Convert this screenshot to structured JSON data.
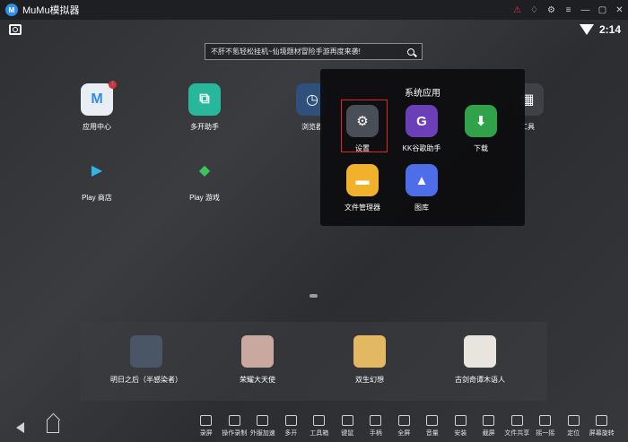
{
  "window": {
    "title": "MuMu模拟器",
    "logo_text": "M"
  },
  "status": {
    "time": "2:14"
  },
  "search": {
    "text": "不肝不氪轻松挂机~仙境题材冒险手游再度来袭!"
  },
  "home_apps": [
    {
      "label": "应用中心",
      "icon": "app-center-icon",
      "color": "#e9eef5",
      "glyph": "M",
      "badge": "1"
    },
    {
      "label": "多开助手",
      "icon": "multi-open-icon",
      "color": "#27b79a",
      "glyph": "⧉"
    },
    {
      "label": "浏览器",
      "icon": "browser-icon",
      "color": "#2f4f7c",
      "glyph": "◷"
    },
    {
      "label": "工具",
      "icon": "tools-icon",
      "color": "#3e4247",
      "glyph": "▦"
    },
    {
      "label": "Play 商店",
      "icon": "play-store-icon",
      "color": "transparent",
      "glyph": "▶"
    },
    {
      "label": "Play 游戏",
      "icon": "play-games-icon",
      "color": "transparent",
      "glyph": "◆"
    }
  ],
  "folder": {
    "title": "系统应用",
    "items": [
      {
        "label": "设置",
        "icon": "settings-gear-icon",
        "color": "#4a4e56",
        "glyph": "⚙"
      },
      {
        "label": "KK谷歌助手",
        "icon": "kk-google-icon",
        "color": "#6a3fb8",
        "glyph": "G"
      },
      {
        "label": "下载",
        "icon": "download-icon",
        "color": "#2fa24a",
        "glyph": "⬇"
      },
      {
        "label": "文件管理器",
        "icon": "file-manager-icon",
        "color": "#f2b12a",
        "glyph": "▬"
      },
      {
        "label": "图库",
        "icon": "gallery-icon",
        "color": "#4d6ee8",
        "glyph": "▲"
      }
    ]
  },
  "dock_apps": [
    {
      "label": "明日之后（半感染者）",
      "icon": "game-lifeafter-icon",
      "color": "#4a5666"
    },
    {
      "label": "荣耀大天使",
      "icon": "game-archangel-icon",
      "color": "#c9a8a0"
    },
    {
      "label": "双生幻想",
      "icon": "game-twin-fantasy-icon",
      "color": "#e3b862"
    },
    {
      "label": "古剑奇谭木语人",
      "icon": "game-gujian-icon",
      "color": "#e8e4de"
    }
  ],
  "toolbar": [
    {
      "label": "录屏",
      "icon": "record-screen-icon"
    },
    {
      "label": "操作录制",
      "icon": "macro-record-icon"
    },
    {
      "label": "外服加速",
      "icon": "accelerate-icon"
    },
    {
      "label": "多开",
      "icon": "multi-instance-icon"
    },
    {
      "label": "工具箱",
      "icon": "toolbox-icon"
    },
    {
      "label": "键鼠",
      "icon": "keyboard-icon"
    },
    {
      "label": "手柄",
      "icon": "gamepad-icon"
    },
    {
      "label": "全屏",
      "icon": "fullscreen-icon"
    },
    {
      "label": "音量",
      "icon": "volume-icon"
    },
    {
      "label": "安装",
      "icon": "apk-install-icon"
    },
    {
      "label": "截屏",
      "icon": "screenshot-icon"
    },
    {
      "label": "文件共享",
      "icon": "file-share-icon"
    },
    {
      "label": "摇一摇",
      "icon": "shake-icon"
    },
    {
      "label": "定位",
      "icon": "location-icon"
    },
    {
      "label": "屏幕旋转",
      "icon": "rotate-icon"
    }
  ]
}
